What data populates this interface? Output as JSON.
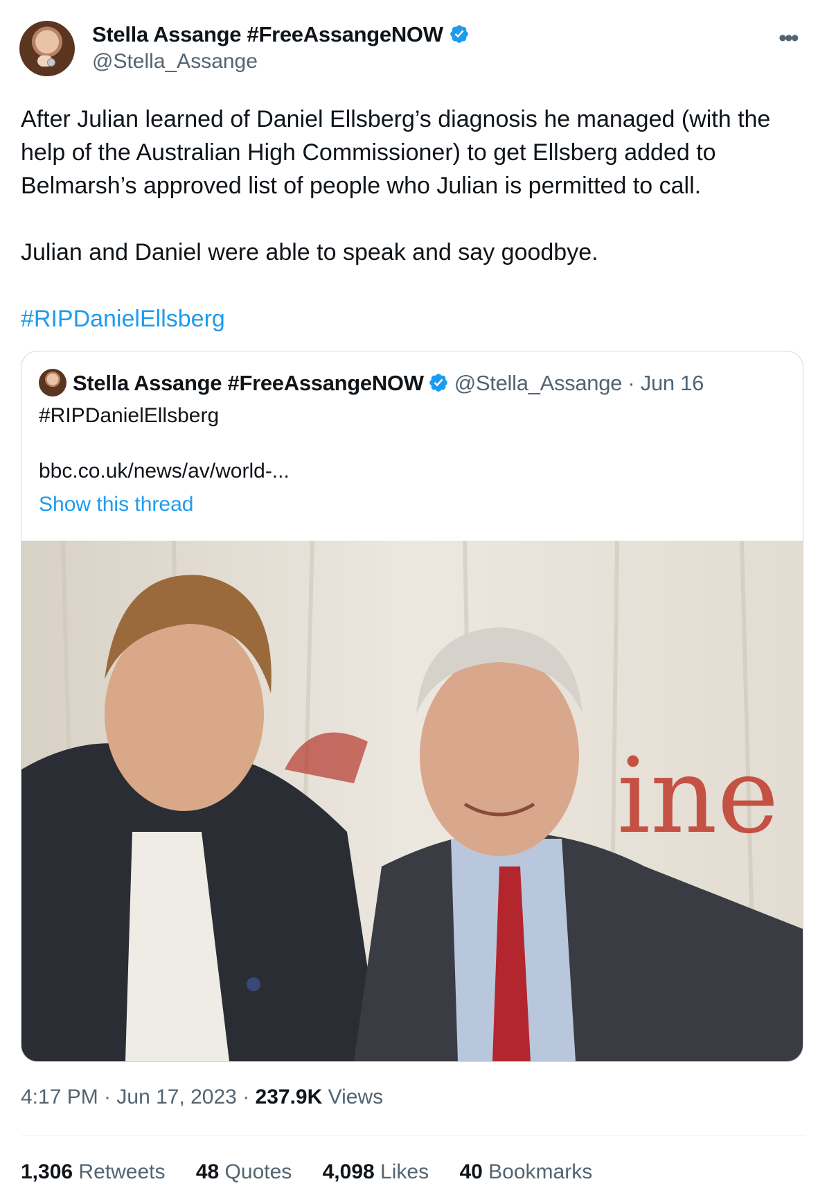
{
  "author": {
    "name": "Stella Assange #FreeAssangeNOW",
    "handle": "@Stella_Assange",
    "badge_color": "#1d9bf0"
  },
  "more_icon": "•••",
  "body": {
    "paragraph1": "After Julian learned of Daniel Ellsberg’s diagnosis he managed (with the help of the Australian High Commissioner) to get Ellsberg added to Belmarsh’s approved list of people who Julian is permitted to call.",
    "paragraph2": "Julian and Daniel were able to speak and say goodbye.",
    "hashtag": "#RIPDanielEllsberg"
  },
  "quoted_tweet": {
    "name": "Stella Assange #FreeAssangeNOW",
    "meta": "@Stella_Assange · Jun 16",
    "text": "#RIPDanielEllsberg",
    "link": "bbc.co.uk/news/av/world-...",
    "show_thread": "Show this thread",
    "image_banner_text": "ine"
  },
  "footer": {
    "time": "4:17 PM · Jun 17, 2023 · ",
    "views_count": "237.9K",
    "views_label": "Views"
  },
  "stats": [
    {
      "count": "1,306",
      "label": "Retweets"
    },
    {
      "count": "48",
      "label": "Quotes"
    },
    {
      "count": "4,098",
      "label": "Likes"
    },
    {
      "count": "40",
      "label": "Bookmarks"
    }
  ]
}
